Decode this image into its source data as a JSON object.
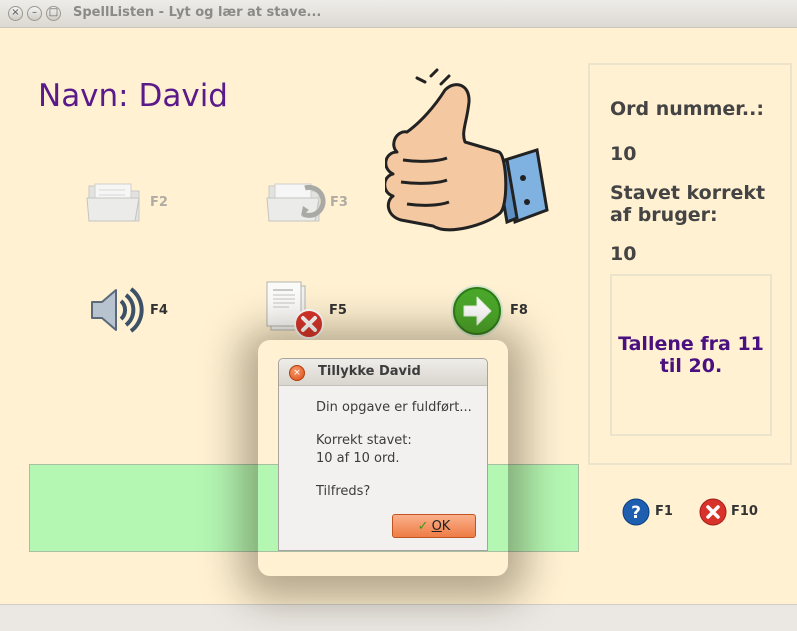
{
  "window": {
    "title": "SpellListen - Lyt og lær at stave...",
    "close_glyph": "×",
    "min_glyph": "–",
    "max_glyph": "□"
  },
  "main": {
    "navn_label": "Navn: David",
    "toolbar": {
      "open_key": "F2",
      "save_key": "F3",
      "listen_key": "F4",
      "delete_key": "F5",
      "next_key": "F8"
    },
    "help_key": "F1",
    "quit_key": "F10"
  },
  "right_panel": {
    "word_number_label": "Ord nummer..:",
    "word_number_value": "10",
    "correct_label_line1": "Stavet korrekt",
    "correct_label_line2": "af bruger:",
    "correct_value": "10",
    "list_text": "Tallene fra 11 til 20."
  },
  "dialog": {
    "title": "Tillykke David",
    "close_glyph": "×",
    "line1": "Din opgave er fuldført...",
    "line2": "Korrekt stavet:",
    "line3": "10 af 10 ord.",
    "line4": "Tilfreds?",
    "ok_check": "✓",
    "ok_label_underlined": "O",
    "ok_label_rest": "K"
  },
  "colors": {
    "background": "#fff1d2",
    "name_text": "#5a1a8a",
    "list_text": "#4a1080",
    "answer_box": "#b4f7b3",
    "ok_button": "#ee7c45"
  }
}
